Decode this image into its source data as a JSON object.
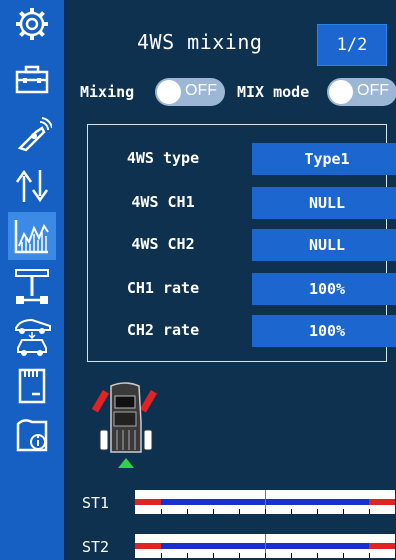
{
  "header": {
    "title": "4WS mixing",
    "page_indicator": "1/2"
  },
  "mixing": {
    "label": "Mixing",
    "state": "OFF"
  },
  "mix_mode": {
    "label": "MIX mode",
    "state": "OFF"
  },
  "rows": [
    {
      "label": "4WS type",
      "value": "Type1"
    },
    {
      "label": "4WS CH1",
      "value": "NULL"
    },
    {
      "label": "4WS CH2",
      "value": "NULL"
    },
    {
      "label": "CH1 rate",
      "value": "100%"
    },
    {
      "label": "CH2 rate",
      "value": "100%"
    }
  ],
  "channels": [
    {
      "label": "ST1",
      "red_end_fraction": 0.1,
      "blue_fraction": 0.8
    },
    {
      "label": "ST2",
      "red_end_fraction": 0.1,
      "blue_fraction": 0.8
    }
  ],
  "sidebar": {
    "icons": [
      "gear-icon",
      "toolbox-icon",
      "transmitter-icon",
      "updown-arrows-icon",
      "chart-icon",
      "axle-icon",
      "car-mix-icon",
      "sd-card-icon",
      "info-icon"
    ],
    "active": "chart-icon"
  },
  "colors": {
    "accent": "#1b66cf",
    "background": "#0f3150",
    "sidebar": "#1560c2",
    "wheel_red": "#e02424",
    "arrow_green": "#2fd14a"
  }
}
